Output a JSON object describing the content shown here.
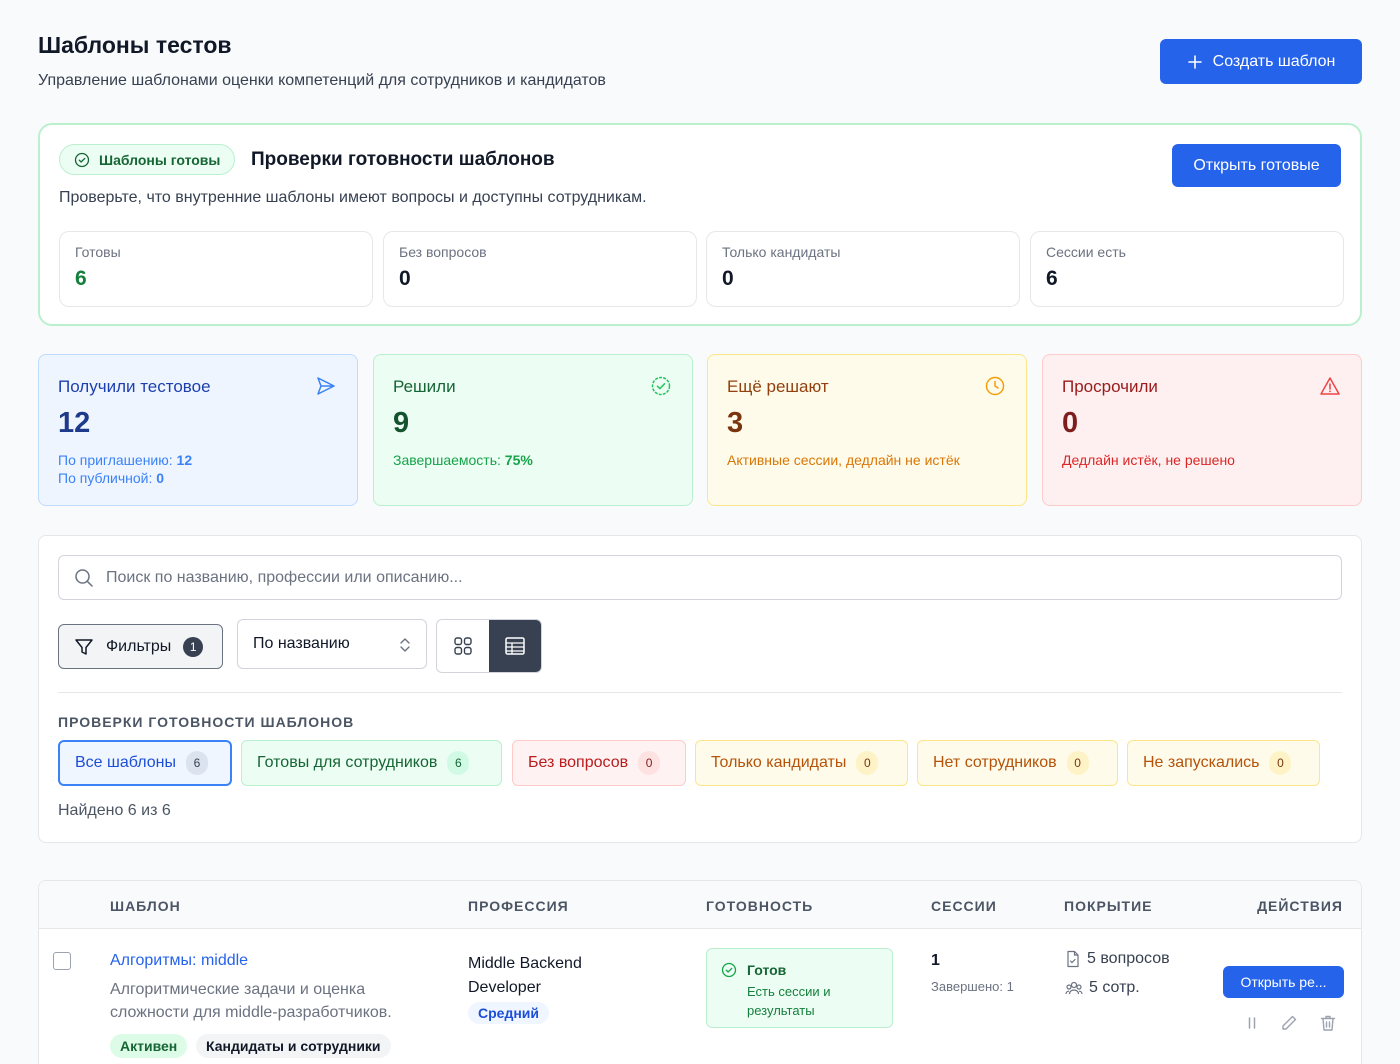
{
  "header": {
    "title": "Шаблоны тестов",
    "subtitle": "Управление шаблонами оценки компетенций для сотрудников и кандидатов",
    "create_button": "Создать шаблон"
  },
  "readiness": {
    "badge": "Шаблоны готовы",
    "title": "Проверки готовности шаблонов",
    "open_button": "Открыть готовые",
    "description": "Проверьте, что внутренние шаблоны имеют вопросы и доступны сотрудникам.",
    "stats": [
      {
        "label": "Готовы",
        "value": "6"
      },
      {
        "label": "Без вопросов",
        "value": "0"
      },
      {
        "label": "Только кандидаты",
        "value": "0"
      },
      {
        "label": "Сессии есть",
        "value": "6"
      }
    ]
  },
  "stats": {
    "received": {
      "label": "Получили тестовое",
      "value": "12",
      "sub1_label": "По приглашению:",
      "sub1_value": "12",
      "sub2_label": "По публичной:",
      "sub2_value": "0"
    },
    "solved": {
      "label": "Решили",
      "value": "9",
      "sub_label": "Завершаемость:",
      "sub_value": "75%"
    },
    "solving": {
      "label": "Ещё решают",
      "value": "3",
      "sub": "Активные сессии, дедлайн не истёк"
    },
    "overdue": {
      "label": "Просрочили",
      "value": "0",
      "sub": "Дедлайн истёк, не решено"
    }
  },
  "filters": {
    "search_placeholder": "Поиск по названию, профессии или описанию...",
    "filters_button": "Фильтры",
    "filters_count": "1",
    "sort_value": "По названию",
    "section_label": "ПРОВЕРКИ ГОТОВНОСТИ ШАБЛОНОВ",
    "chips": [
      {
        "label": "Все шаблоны",
        "count": "6"
      },
      {
        "label": "Готовы для сотрудников",
        "count": "6"
      },
      {
        "label": "Без вопросов",
        "count": "0"
      },
      {
        "label": "Только кандидаты",
        "count": "0"
      },
      {
        "label": "Нет сотрудников",
        "count": "0"
      },
      {
        "label": "Не запускались",
        "count": "0"
      }
    ],
    "found_text": "Найдено 6 из 6"
  },
  "table": {
    "columns": [
      "ШАБЛОН",
      "ПРОФЕССИЯ",
      "ГОТОВНОСТЬ",
      "СЕССИИ",
      "ПОКРЫТИЕ",
      "ДЕЙСТВИЯ"
    ],
    "rows": [
      {
        "name": "Алгоритмы: middle",
        "description": "Алгоритмические задачи и оценка сложности для middle-разработчиков.",
        "tags": [
          "Активен",
          "Кандидаты и сотрудники"
        ],
        "profession": "Middle Backend Developer",
        "level": "Средний",
        "readiness_title": "Готов",
        "readiness_desc": "Есть сессии и результаты",
        "sessions": "1",
        "sessions_sub": "Завершено: 1",
        "questions": "5 вопросов",
        "employees": "5 сотр.",
        "open_button": "Открыть ре..."
      }
    ]
  },
  "colors": {
    "primary": "#2563eb",
    "success": "#16a34a",
    "warning": "#d97706",
    "danger": "#dc2626"
  }
}
